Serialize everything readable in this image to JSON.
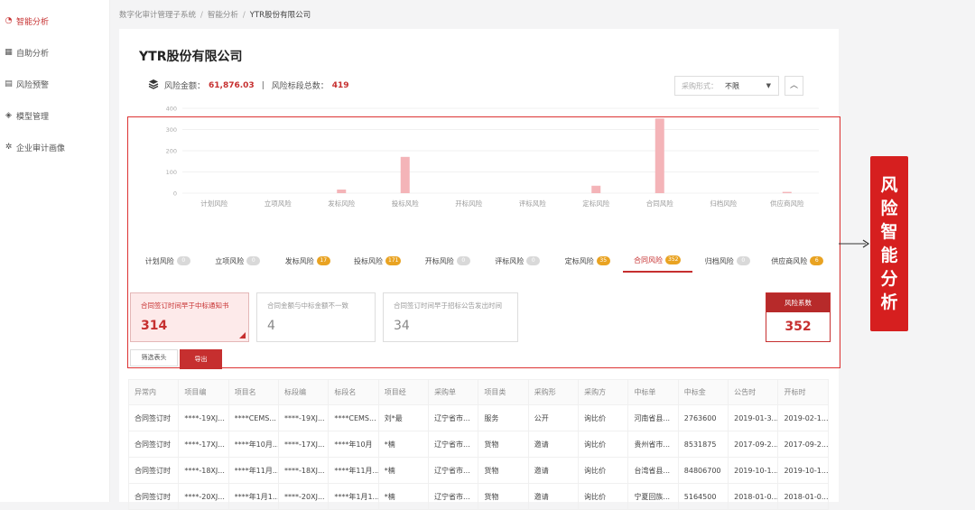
{
  "sidebar": {
    "items": [
      {
        "label": "智能分析",
        "icon": "gauge-icon",
        "active": true
      },
      {
        "label": "自助分析",
        "icon": "grid-icon",
        "active": false
      },
      {
        "label": "风险预警",
        "icon": "doc-icon",
        "active": false
      },
      {
        "label": "模型管理",
        "icon": "cube-icon",
        "active": false
      },
      {
        "label": "企业审计画像",
        "icon": "network-icon",
        "active": false
      }
    ]
  },
  "breadcrumb": [
    "数字化审计管理子系统",
    "智能分析",
    "YTR股份有限公司"
  ],
  "company_title": "YTR股份有限公司",
  "summary": {
    "amount_label": "风险金额：",
    "amount_value": "61,876.03",
    "sep": "|",
    "count_label": "风险标段总数：",
    "count_value": "419"
  },
  "filter": {
    "label": "采购形式：",
    "value": "不限"
  },
  "chart_data": {
    "type": "bar",
    "categories": [
      "计划风险",
      "立项风险",
      "发标风险",
      "投标风险",
      "开标风险",
      "评标风险",
      "定标风险",
      "合同风险",
      "归档风险",
      "供应商风险"
    ],
    "values": [
      0,
      0,
      17,
      171,
      0,
      0,
      35,
      352,
      0,
      6
    ],
    "ylim": [
      0,
      400
    ],
    "yticks": [
      "0",
      "100",
      "200",
      "300",
      "400"
    ],
    "bar_color": "#f4b4b8",
    "grid": true
  },
  "tabs": [
    {
      "label": "计划风险",
      "count": "0",
      "warn": false
    },
    {
      "label": "立项风险",
      "count": "0",
      "warn": false
    },
    {
      "label": "发标风险",
      "count": "17",
      "warn": true
    },
    {
      "label": "投标风险",
      "count": "171",
      "warn": true
    },
    {
      "label": "开标风险",
      "count": "0",
      "warn": false
    },
    {
      "label": "评标风险",
      "count": "0",
      "warn": false
    },
    {
      "label": "定标风险",
      "count": "35",
      "warn": true
    },
    {
      "label": "合同风险",
      "count": "352",
      "warn": true,
      "active": true
    },
    {
      "label": "归档风险",
      "count": "0",
      "warn": false
    },
    {
      "label": "供应商风险",
      "count": "6",
      "warn": true
    }
  ],
  "metrics": [
    {
      "label": "合同签订时间早于中标通知书",
      "value": "314"
    },
    {
      "label": "合同金额与中标金额不一致",
      "value": "4"
    },
    {
      "label": "合同签订时间早于招标公告发出时间",
      "value": "34"
    }
  ],
  "coef": {
    "label": "风险系数",
    "value": "352"
  },
  "buttons": {
    "filter_cols": "筛选表头",
    "export": "导出"
  },
  "table": {
    "headers": [
      "异常内",
      "项目编",
      "项目名",
      "标段编",
      "标段名",
      "项目经",
      "采购单",
      "项目类",
      "采购形",
      "采购方",
      "中标单",
      "中标金",
      "公告时",
      "开标时"
    ],
    "rows": [
      [
        "合同签订时",
        "****-19XJ...",
        "****CEMS...",
        "****-19XJ...",
        "****CEMS...",
        "刘*最",
        "辽宁省市...",
        "服务",
        "公开",
        "询比价",
        "河南省县...",
        "2763600",
        "2019-01-3...",
        "2019-02-1..."
      ],
      [
        "合同签订时",
        "****-17XJ...",
        "****年10月...",
        "****-17XJ...",
        "****年10月",
        "*楠",
        "辽宁省市...",
        "货物",
        "邀请",
        "询比价",
        "贵州省市...",
        "8531875",
        "2017-09-2...",
        "2017-09-2..."
      ],
      [
        "合同签订时",
        "****-18XJ...",
        "****年11月...",
        "****-18XJ...",
        "****年11月...",
        "*楠",
        "辽宁省市...",
        "货物",
        "邀请",
        "询比价",
        "台湾省县...",
        "84806700",
        "2019-10-1...",
        "2019-10-1..."
      ],
      [
        "合同签订时",
        "****-20XJ...",
        "****年1月1...",
        "****-20XJ...",
        "****年1月1...",
        "*楠",
        "辽宁省市...",
        "货物",
        "邀请",
        "询比价",
        "宁夏回族...",
        "5164500",
        "2018-01-0...",
        "2018-01-0..."
      ]
    ]
  },
  "callout": "风险智能分析"
}
